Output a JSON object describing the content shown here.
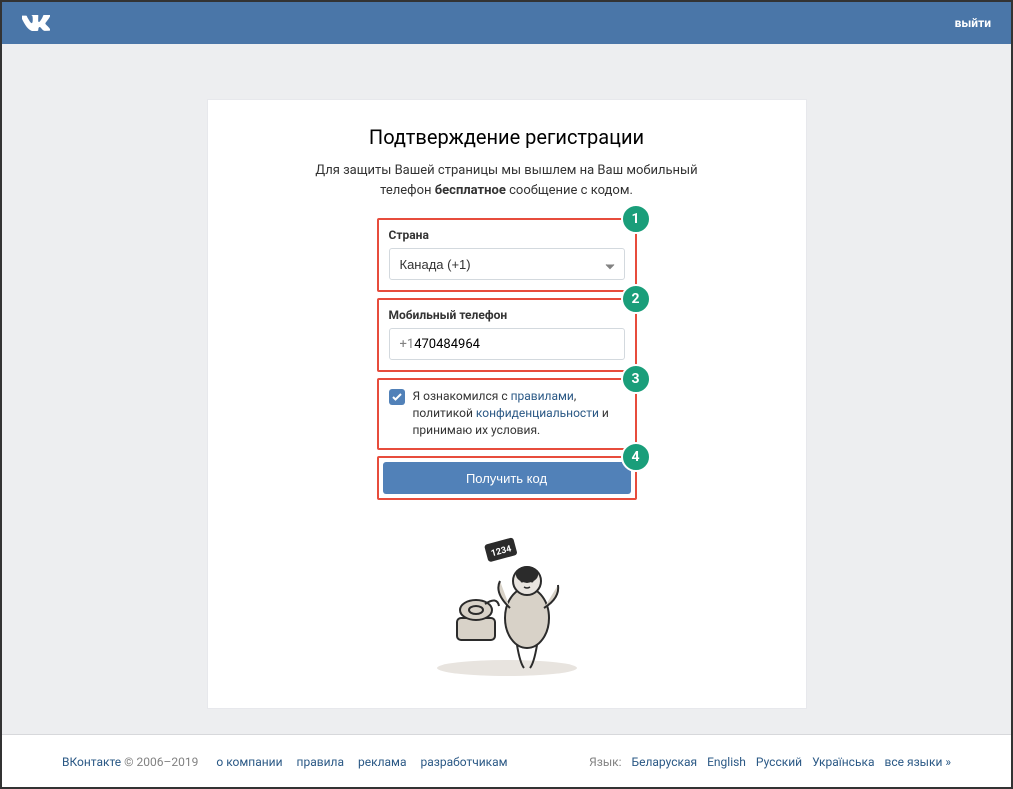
{
  "header": {
    "logout": "выйти"
  },
  "page": {
    "title": "Подтверждение регистрации",
    "subtitle_1": "Для защиты Вашей страницы мы вышлем на Ваш мобильный",
    "subtitle_2a": "телефон ",
    "subtitle_2b": "бесплатное",
    "subtitle_2c": " сообщение с кодом."
  },
  "form": {
    "country_label": "Страна",
    "country_value": "Канада (+1)",
    "phone_label": "Мобильный телефон",
    "phone_prefix": "+1",
    "phone_number": "470484964",
    "terms_1": "Я ознакомился с ",
    "terms_link1": "правилами",
    "terms_2": ", политикой ",
    "terms_link2": "конфиденциальности",
    "terms_3": " и принимаю их условия.",
    "submit": "Получить код"
  },
  "badges": {
    "b1": "1",
    "b2": "2",
    "b3": "3",
    "b4": "4"
  },
  "illustration": {
    "code": "1234"
  },
  "footer": {
    "brand": "ВКонтакте",
    "copyright": " © 2006–2019",
    "nav": {
      "about": "о компании",
      "rules": "правила",
      "ads": "реклама",
      "devs": "разработчикам"
    },
    "lang_label": "Язык:",
    "langs": {
      "by": "Беларуская",
      "en": "English",
      "ru": "Русский",
      "ua": "Українська",
      "all": "все языки »"
    }
  }
}
